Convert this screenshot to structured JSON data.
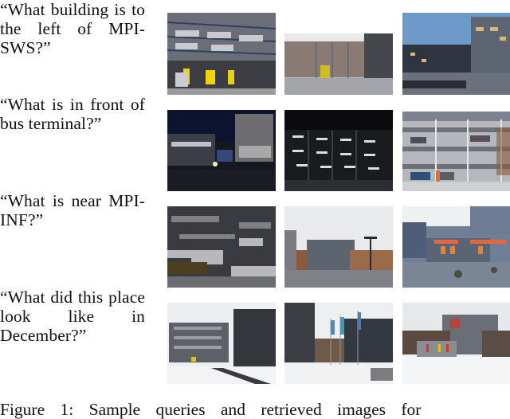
{
  "figure": {
    "rows": [
      {
        "query": "“What building is to the left of MPI-SWS?”",
        "images": [
          {
            "label": "building-facade-yellow-doors",
            "dominant_color": "#6f7177"
          },
          {
            "label": "glass-entrance-plaza",
            "dominant_color": "#8a8b90"
          },
          {
            "label": "dusk-courtyard-building",
            "dominant_color": "#4a6690"
          }
        ]
      },
      {
        "query": "“What is in front of bus terminal?”",
        "images": [
          {
            "label": "night-building-street",
            "dominant_color": "#1a1f2a"
          },
          {
            "label": "night-parking-garage-lit",
            "dominant_color": "#2a2c30"
          },
          {
            "label": "day-parking-garage",
            "dominant_color": "#9a9ca0"
          }
        ]
      },
      {
        "query": "“What is near MPI-INF?”",
        "images": [
          {
            "label": "dark-metal-facade-building",
            "dominant_color": "#3a3b3f"
          },
          {
            "label": "plaza-with-lamp-post",
            "dominant_color": "#7c7f86"
          },
          {
            "label": "courtyard-red-umbrellas",
            "dominant_color": "#6f7e92"
          }
        ]
      },
      {
        "query": "“What did this place look like in December?”",
        "images": [
          {
            "label": "snowy-buildings-path",
            "dominant_color": "#d9dadc"
          },
          {
            "label": "snowy-flags-building",
            "dominant_color": "#cfd0d3"
          },
          {
            "label": "snowy-field-buildings",
            "dominant_color": "#e2e3e5"
          }
        ]
      }
    ],
    "caption": "Figure 1: Sample queries and retrieved images for"
  }
}
